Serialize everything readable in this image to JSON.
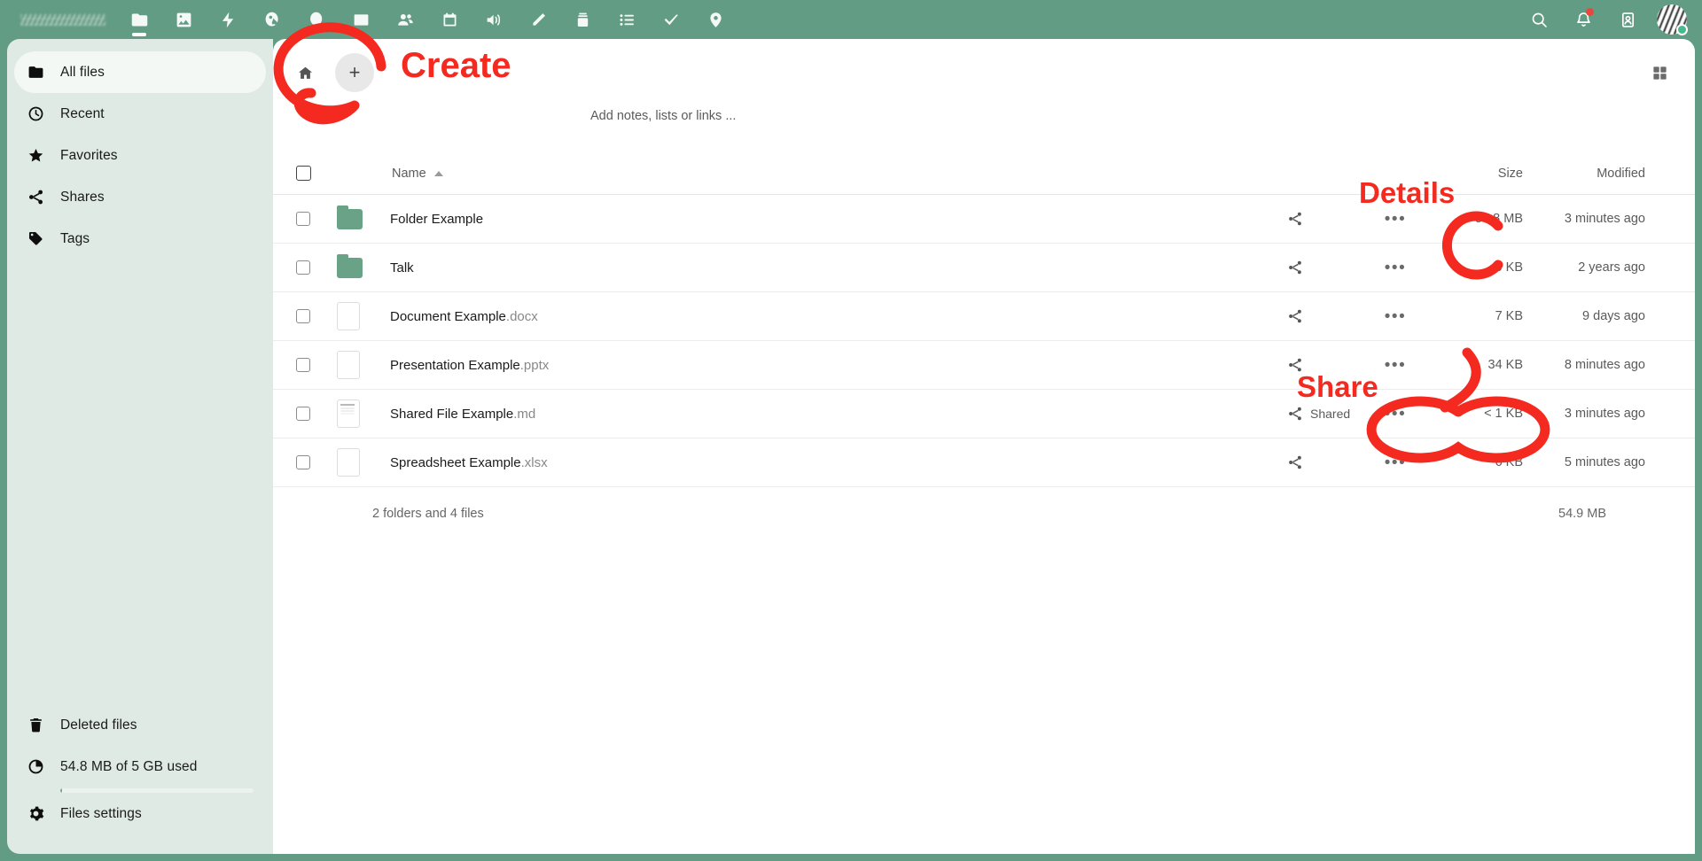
{
  "topbar": {
    "logo_alt": "nextcloud-logo",
    "apps": [
      {
        "name": "files",
        "label": "Files",
        "active": true
      },
      {
        "name": "photos",
        "label": "Photos",
        "active": false
      },
      {
        "name": "activity",
        "label": "Activity",
        "active": false
      },
      {
        "name": "passwords",
        "label": "Passwords",
        "active": false
      },
      {
        "name": "search-app",
        "label": "Search",
        "active": false
      },
      {
        "name": "mail",
        "label": "Mail",
        "active": false
      },
      {
        "name": "contacts",
        "label": "Contacts",
        "active": false
      },
      {
        "name": "calendar",
        "label": "Calendar",
        "active": false
      },
      {
        "name": "announcements",
        "label": "Announcements",
        "active": false
      },
      {
        "name": "notes",
        "label": "Notes",
        "active": false
      },
      {
        "name": "collectives",
        "label": "Collectives",
        "active": false
      },
      {
        "name": "tasks",
        "label": "Tasks",
        "active": false
      },
      {
        "name": "checks",
        "label": "Checks",
        "active": false
      },
      {
        "name": "maps",
        "label": "Maps",
        "active": false
      }
    ],
    "search_label": "Search",
    "notifications_label": "Notifications",
    "contacts_menu_label": "Contacts",
    "avatar_label": "User menu",
    "avatar_status": "online",
    "accent_color": "#639C84",
    "notification_dot_color": "#e8473b",
    "status_dot_color": "#46ba8c"
  },
  "sidebar": {
    "items": [
      {
        "label": "All files",
        "icon": "folder-icon",
        "active": true
      },
      {
        "label": "Recent",
        "icon": "clock-icon",
        "active": false
      },
      {
        "label": "Favorites",
        "icon": "star-icon",
        "active": false
      },
      {
        "label": "Shares",
        "icon": "share-icon",
        "active": false
      },
      {
        "label": "Tags",
        "icon": "tag-icon",
        "active": false
      }
    ],
    "bottom": [
      {
        "label": "Deleted files",
        "icon": "trash-icon"
      },
      {
        "label": "54.8 MB of 5 GB used",
        "icon": "pie-chart-icon"
      },
      {
        "label": "Files settings",
        "icon": "gear-icon"
      }
    ],
    "quota_percent": 1
  },
  "content": {
    "home_icon": "home-icon",
    "create_button_label": "+",
    "create_hint": "Add notes, lists or links ...",
    "grid_toggle_label": "Switch to grid view"
  },
  "table": {
    "headers": {
      "name": "Name",
      "size": "Size",
      "modified": "Modified",
      "sort_direction": "ascending"
    },
    "rows": [
      {
        "name": "Folder Example",
        "ext": "",
        "type": "folder",
        "share_label": "",
        "size": "54.8 MB",
        "modified": "3 minutes ago"
      },
      {
        "name": "Talk",
        "ext": "",
        "type": "folder",
        "share_label": "",
        "size": "0 KB",
        "modified": "2 years ago"
      },
      {
        "name": "Document Example",
        "ext": ".docx",
        "type": "file",
        "share_label": "",
        "size": "7 KB",
        "modified": "9 days ago"
      },
      {
        "name": "Presentation Example",
        "ext": ".pptx",
        "type": "file",
        "share_label": "",
        "size": "34 KB",
        "modified": "8 minutes ago"
      },
      {
        "name": "Shared File Example",
        "ext": ".md",
        "type": "file-md",
        "share_label": "Shared",
        "size": "< 1 KB",
        "modified": "3 minutes ago"
      },
      {
        "name": "Spreadsheet Example",
        "ext": ".xlsx",
        "type": "file",
        "share_label": "",
        "size": "6 KB",
        "modified": "5 minutes ago"
      }
    ],
    "summary_left": "2 folders and 4 files",
    "summary_right": "54.9 MB"
  },
  "annotations": {
    "color": "#f42a20",
    "create": "Create",
    "details": "Details",
    "share": "Share"
  }
}
